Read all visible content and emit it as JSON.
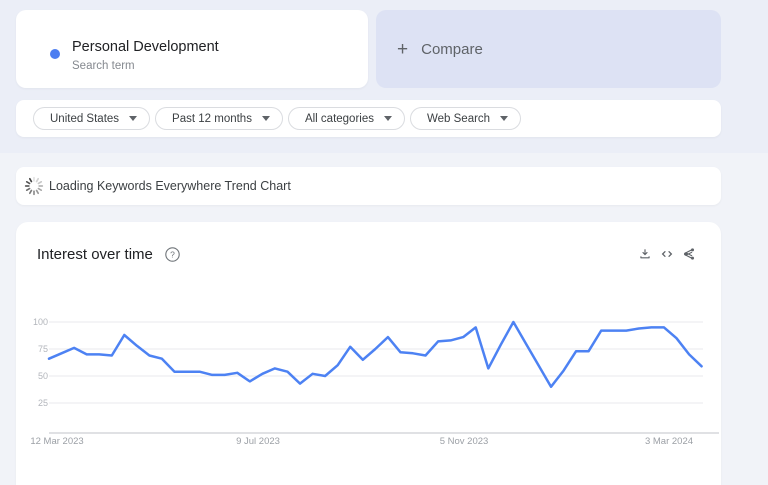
{
  "search_card": {
    "term": "Personal Development",
    "subtitle": "Search term",
    "dot_color": "#4C7EF1"
  },
  "compare_card": {
    "plus": "+",
    "label": "Compare"
  },
  "filters": {
    "items": [
      {
        "label": "United States"
      },
      {
        "label": "Past 12 months"
      },
      {
        "label": "All categories"
      },
      {
        "label": "Web Search"
      }
    ]
  },
  "loading": {
    "text": "Loading Keywords Everywhere Trend Chart"
  },
  "chart_card": {
    "title": "Interest over time"
  },
  "chart_data": {
    "type": "line",
    "title": "Interest over time",
    "series_name": "Personal Development",
    "x_unit": "week",
    "x_tick_labels": [
      {
        "label": "12 Mar 2023",
        "index": 0
      },
      {
        "label": "9 Jul 2023",
        "index": 17
      },
      {
        "label": "5 Nov 2023",
        "index": 34
      },
      {
        "label": "3 Mar 2024",
        "index": 51
      }
    ],
    "y_ticks": [
      "100",
      "75",
      "50",
      "25"
    ],
    "ylim": [
      0,
      100
    ],
    "grid": true,
    "legend": "none",
    "line_color": "#4D82F3",
    "grid_color": "#E9EAEE",
    "axis_color": "#CDCFD4",
    "values": [
      66,
      71,
      76,
      70,
      70,
      69,
      88,
      78,
      69,
      66,
      54,
      54,
      54,
      51,
      51,
      53,
      45,
      52,
      57,
      54,
      43,
      52,
      50,
      60,
      77,
      65,
      75,
      86,
      72,
      71,
      69,
      82,
      83,
      86,
      95,
      57,
      79,
      100,
      80,
      60,
      40,
      55,
      73,
      73,
      92,
      92,
      92,
      94,
      95,
      95,
      85,
      70,
      59
    ]
  }
}
